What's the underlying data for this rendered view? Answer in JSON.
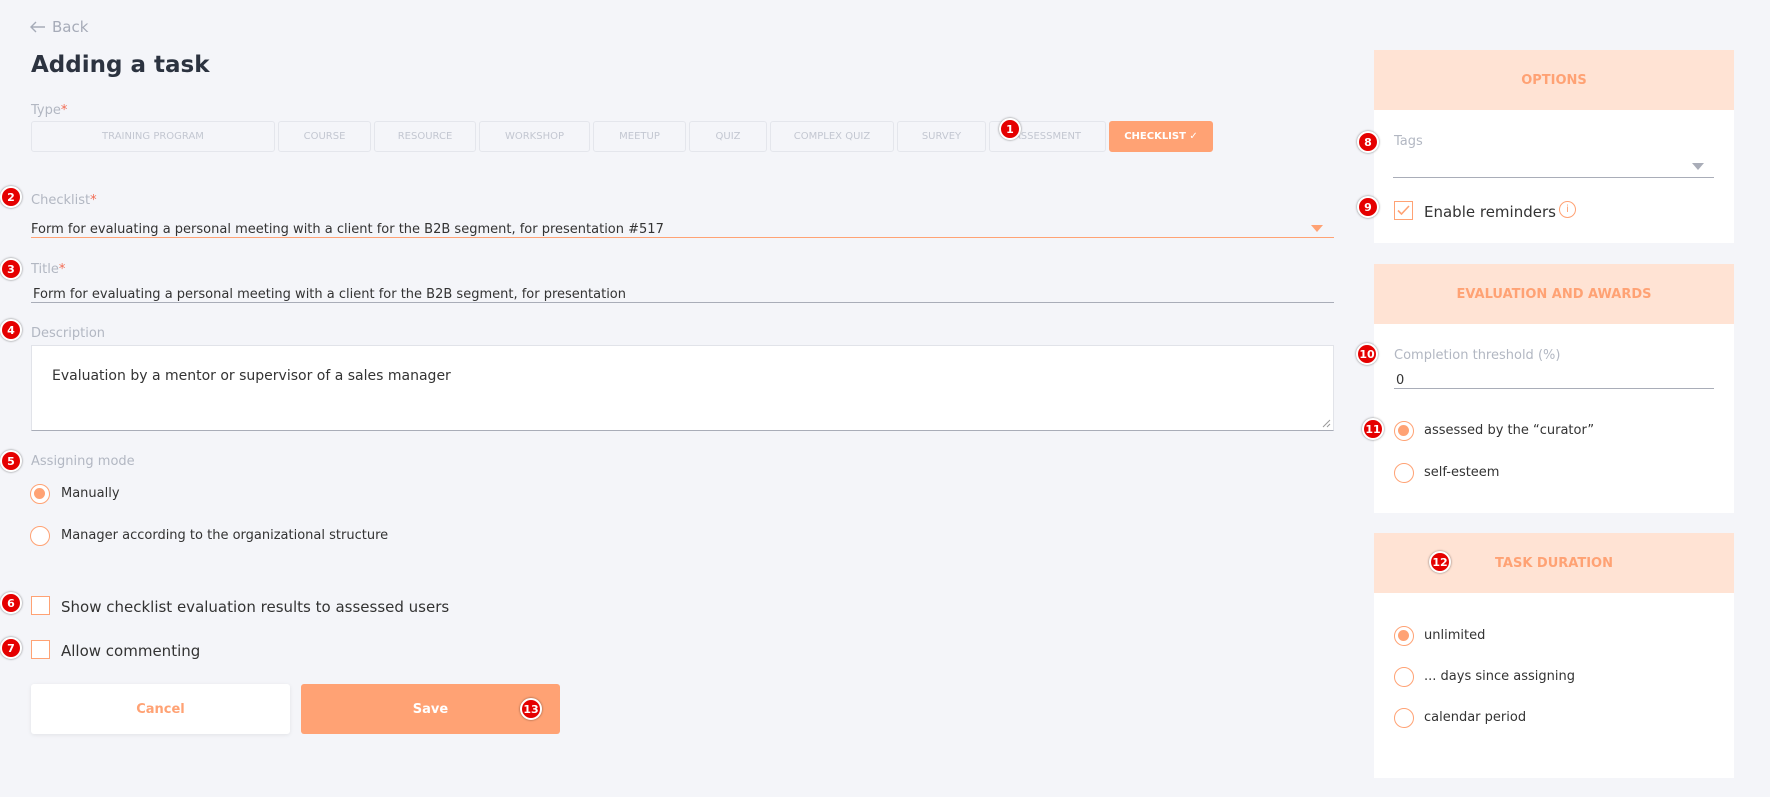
{
  "nav": {
    "back_label": "Back"
  },
  "page": {
    "title": "Adding a task"
  },
  "type": {
    "label": "Type",
    "required_mark": "*",
    "options": [
      "Training program",
      "Course",
      "Resource",
      "Workshop",
      "Meetup",
      "Quiz",
      "Complex quiz",
      "Survey",
      "Assessment"
    ],
    "selected": "Checklist ✓"
  },
  "checklist": {
    "label": "Checklist",
    "required_mark": "*",
    "value": "Form for evaluating a personal meeting with a client for the B2B segment, for presentation #517"
  },
  "title_field": {
    "label": "Title",
    "required_mark": "*",
    "value": "Form for evaluating a personal meeting with a client for the B2B segment, for presentation"
  },
  "description": {
    "label": "Description",
    "value": "Evaluation by a mentor or supervisor of a sales manager"
  },
  "assigning_mode": {
    "label": "Assigning mode",
    "options": [
      "Manually",
      "Manager according to the organizational structure"
    ],
    "selected": "Manually"
  },
  "checkboxes": {
    "show_results": "Show checklist evaluation results to assessed users",
    "allow_commenting": "Allow commenting"
  },
  "actions": {
    "cancel": "Cancel",
    "save": "Save"
  },
  "options_panel": {
    "header": "Options",
    "tags_label": "Tags",
    "reminders_label": "Enable reminders",
    "reminders_checked": true
  },
  "evaluation_panel": {
    "header": "Evaluation and awards",
    "threshold_label": "Completion threshold (%)",
    "threshold_value": "0",
    "options": [
      "assessed by the “curator”",
      "self-esteem"
    ],
    "selected": "assessed by the “curator”"
  },
  "duration_panel": {
    "header": "Task duration",
    "options": [
      "unlimited",
      "... days since assigning",
      "calendar period"
    ],
    "selected": "unlimited"
  },
  "annotations": [
    "1",
    "2",
    "3",
    "4",
    "5",
    "6",
    "7",
    "8",
    "9",
    "10",
    "11",
    "12",
    "13"
  ],
  "colors": {
    "accent": "#ffa274",
    "panel_header": "#ffe3d4",
    "badge": "#e50000",
    "background": "#f4f5f9"
  }
}
